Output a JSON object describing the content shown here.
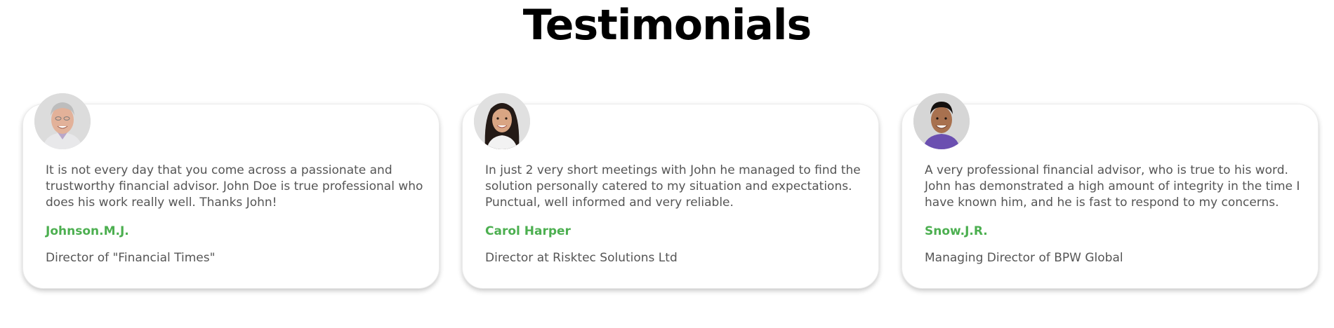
{
  "section": {
    "title": "Testimonials"
  },
  "colors": {
    "name_accent": "#4caf50",
    "text": "#555555",
    "heading": "#000000"
  },
  "testimonials": [
    {
      "avatar_icon": "senior-man-avatar",
      "quote": "It is not every day that you come across a passionate and trustworthy financial advisor. John Doe is true professional who does his work really well. Thanks John!",
      "name": "Johnson.M.J.",
      "role": "Director of \"Financial Times\""
    },
    {
      "avatar_icon": "woman-avatar",
      "quote": "In just 2 very short meetings with John he managed to find the solution personally catered to my situation and expectations. Punctual, well informed and very reliable.",
      "name": "Carol Harper",
      "role": "Director at Risktec Solutions Ltd"
    },
    {
      "avatar_icon": "young-man-avatar",
      "quote": "A very professional financial advisor, who is true to his word. John has demonstrated a high amount of integrity in the time I have known him, and he is fast to respond to my concerns.",
      "name": "Snow.J.R.",
      "role": "Managing Director of BPW Global"
    }
  ]
}
